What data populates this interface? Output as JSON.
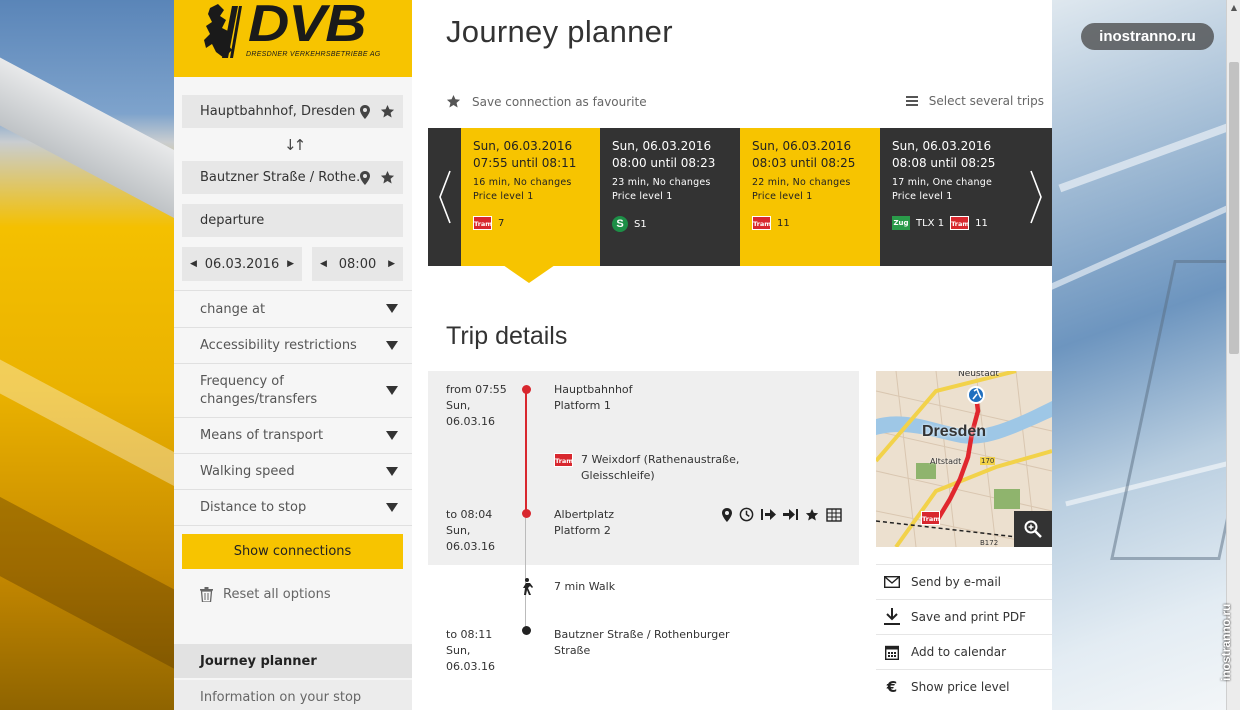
{
  "watermark": {
    "pill": "inostranno.ru",
    "vertical": "inostranno.ru"
  },
  "logo": {
    "name": "DVB",
    "subtitle": "DRESDNER VERKEHRSBETRIEBE AG"
  },
  "sidebar": {
    "from": "Hauptbahnhof, Dresden",
    "to": "Bautzner Straße / Rothe…",
    "mode": "departure",
    "date": "06.03.2016",
    "time": "08:00",
    "options": [
      {
        "label": "change at"
      },
      {
        "label": "Accessibility restrictions"
      },
      {
        "label": "Frequency of changes/transfers"
      },
      {
        "label": "Means of transport"
      },
      {
        "label": "Walking speed"
      },
      {
        "label": "Distance to stop"
      }
    ],
    "show_button": "Show connections",
    "reset": "Reset all options",
    "nav": {
      "active": "Journey planner",
      "next": "Information on your stop"
    }
  },
  "main": {
    "title": "Journey planner",
    "fav": "Save connection as favourite",
    "multi": "Select several trips",
    "trip_details_title": "Trip details"
  },
  "connections": [
    {
      "date": "Sun, 06.03.2016",
      "time": "07:55 until 08:11",
      "info": "16 min, No changes",
      "price": "Price level 1",
      "lines": [
        {
          "type": "tram",
          "badge": "Tram",
          "num": "7"
        }
      ],
      "selected": true
    },
    {
      "date": "Sun, 06.03.2016",
      "time": "08:00 until 08:23",
      "info": "23 min, No changes",
      "price": "Price level 1",
      "lines": [
        {
          "type": "s",
          "badge": "S",
          "num": "S1"
        }
      ],
      "selected": false
    },
    {
      "date": "Sun, 06.03.2016",
      "time": "08:03 until 08:25",
      "info": "22 min, No changes",
      "price": "Price level 1",
      "lines": [
        {
          "type": "tram",
          "badge": "Tram",
          "num": "11"
        }
      ],
      "selected": true
    },
    {
      "date": "Sun, 06.03.2016",
      "time": "08:08 until 08:25",
      "info": "17 min, One change",
      "price": "Price level 1",
      "lines": [
        {
          "type": "zug",
          "badge": "Zug",
          "num": "TLX 1"
        },
        {
          "type": "tram",
          "badge": "Tram",
          "num": "11"
        }
      ],
      "selected": false
    }
  ],
  "trip": {
    "from": {
      "time": "from 07:55",
      "day": "Sun,",
      "date": "06.03.16",
      "stop": "Hauptbahnhof",
      "platform": "Platform 1"
    },
    "ride": {
      "badge": "Tram",
      "line1": "7 Weixdorf (Rathenaustraße,",
      "line2": "Gleisschleife)"
    },
    "to": {
      "time": "to 08:04",
      "day": "Sun,",
      "date": "06.03.16",
      "stop": "Albertplatz",
      "platform": "Platform 2"
    },
    "walk": "7 min Walk",
    "end": {
      "time": "to 08:11",
      "day": "Sun,",
      "date": "06.03.16",
      "stop1": "Bautzner Straße / Rothenburger",
      "stop2": "Straße"
    }
  },
  "map": {
    "city": "Dresden",
    "district1": "Neustadt",
    "district2": "Altstadt",
    "road": "B172",
    "road2": "170",
    "badge": "Tram"
  },
  "actions": [
    {
      "icon": "envelope-icon",
      "label": "Send by e-mail"
    },
    {
      "icon": "download-icon",
      "label": "Save and print PDF"
    },
    {
      "icon": "calendar-icon",
      "label": "Add to calendar"
    },
    {
      "icon": "euro-icon",
      "label": "Show price level"
    }
  ],
  "colors": {
    "yellow": "#f7c400",
    "dark": "#333333",
    "tram_red": "#d8272e",
    "s_green": "#1d8f47"
  }
}
